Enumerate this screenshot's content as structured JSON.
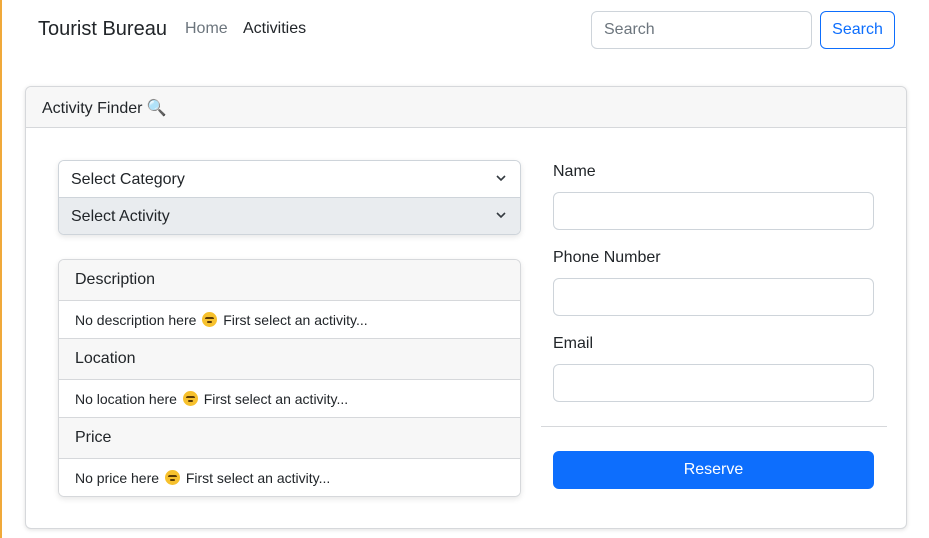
{
  "navbar": {
    "brand": "Tourist Bureau",
    "links": [
      {
        "label": "Home",
        "active": false
      },
      {
        "label": "Activities",
        "active": true
      }
    ],
    "search": {
      "placeholder": "Search",
      "value": "",
      "button_label": "Search"
    }
  },
  "card": {
    "title": "Activity Finder 🔍",
    "category_select": {
      "selected": "Select Category"
    },
    "activity_select": {
      "selected": "Select Activity"
    },
    "info": {
      "description": {
        "heading": "Description",
        "before": "No description here",
        "after": "First select an activity..."
      },
      "location": {
        "heading": "Location",
        "before": "No location here",
        "after": "First select an activity..."
      },
      "price": {
        "heading": "Price",
        "before": "No price here",
        "after": "First select an activity..."
      }
    },
    "form": {
      "name_label": "Name",
      "name_value": "",
      "phone_label": "Phone Number",
      "phone_value": "",
      "email_label": "Email",
      "email_value": "",
      "reserve_label": "Reserve"
    }
  },
  "icons": {
    "chevron": "chevron-down-icon",
    "emoji": "angry-face-icon",
    "search": "magnifier-icon"
  },
  "colors": {
    "primary": "#0d6efd",
    "header_bg": "#f7f7f7",
    "select_active_bg": "#e9ecef",
    "page_edge": "#f0a93a"
  }
}
